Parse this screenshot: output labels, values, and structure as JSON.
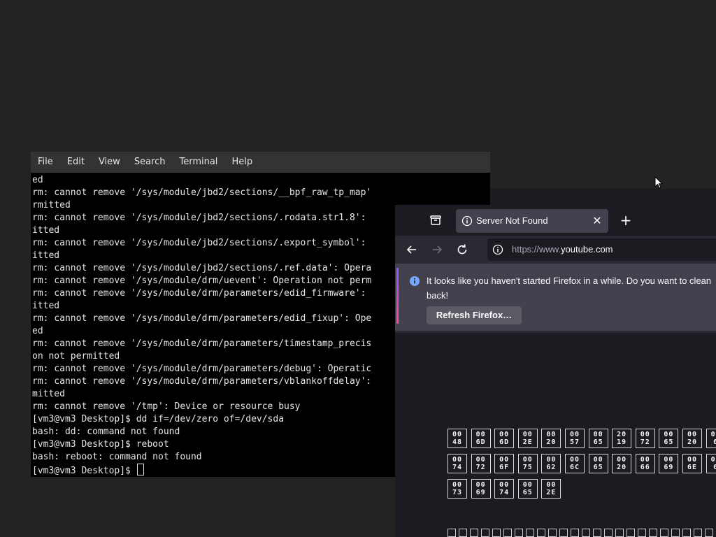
{
  "terminal": {
    "menu": [
      "File",
      "Edit",
      "View",
      "Search",
      "Terminal",
      "Help"
    ],
    "lines": [
      "ed",
      "rm: cannot remove '/sys/module/jbd2/sections/__bpf_raw_tp_map'",
      "rmitted",
      "rm: cannot remove '/sys/module/jbd2/sections/.rodata.str1.8':",
      "itted",
      "rm: cannot remove '/sys/module/jbd2/sections/.export_symbol':",
      "itted",
      "rm: cannot remove '/sys/module/jbd2/sections/.ref.data': Opera",
      "rm: cannot remove '/sys/module/drm/uevent': Operation not perm",
      "rm: cannot remove '/sys/module/drm/parameters/edid_firmware':",
      "itted",
      "rm: cannot remove '/sys/module/drm/parameters/edid_fixup': Ope",
      "ed",
      "rm: cannot remove '/sys/module/drm/parameters/timestamp_precis",
      "on not permitted",
      "rm: cannot remove '/sys/module/drm/parameters/debug': Operatic",
      "rm: cannot remove '/sys/module/drm/parameters/vblankoffdelay':",
      "mitted",
      "rm: cannot remove '/tmp': Device or resource busy",
      "[vm3@vm3 Desktop]$ dd if=/dev/zero of=/dev/sda",
      "bash: dd: command not found",
      "[vm3@vm3 Desktop]$ reboot",
      "bash: reboot: command not found"
    ],
    "prompt": "[vm3@vm3 Desktop]$ "
  },
  "firefox": {
    "tab": {
      "title": "Server Not Found",
      "icon": "info-icon",
      "close": "✕"
    },
    "new_tab": "+",
    "url": {
      "prefix": "https://www.",
      "host": "youtube.com"
    },
    "notification": {
      "line1": "It looks like you haven't started Firefox in a while. Do you want to clean",
      "line2": "back!",
      "button": "Refresh Firefox…"
    },
    "hex_rows": [
      [
        [
          "00",
          "48"
        ],
        [
          "00",
          "6D"
        ],
        [
          "00",
          "6D"
        ],
        [
          "00",
          "2E"
        ],
        [
          "00",
          "20"
        ],
        [
          "00",
          "57"
        ],
        [
          "00",
          "65"
        ],
        [
          "20",
          "19"
        ],
        [
          "00",
          "72"
        ],
        [
          "00",
          "65"
        ],
        [
          "00",
          "20"
        ],
        [
          "00",
          "6"
        ]
      ],
      [
        [
          "00",
          "74"
        ],
        [
          "00",
          "72"
        ],
        [
          "00",
          "6F"
        ],
        [
          "00",
          "75"
        ],
        [
          "00",
          "62"
        ],
        [
          "00",
          "6C"
        ],
        [
          "00",
          "65"
        ],
        [
          "00",
          "20"
        ],
        [
          "00",
          "66"
        ],
        [
          "00",
          "69"
        ],
        [
          "00",
          "6E"
        ],
        [
          "00",
          "6"
        ]
      ],
      [
        [
          "00",
          "73"
        ],
        [
          "00",
          "69"
        ],
        [
          "00",
          "74"
        ],
        [
          "00",
          "65"
        ],
        [
          "00",
          "2E"
        ]
      ]
    ]
  },
  "colors": {
    "desktop": "#232323",
    "terminal_bg": "#000000",
    "terminal_menubar": "#333333",
    "firefox_bg": "#1c1b22",
    "accent": "#9059ff"
  }
}
